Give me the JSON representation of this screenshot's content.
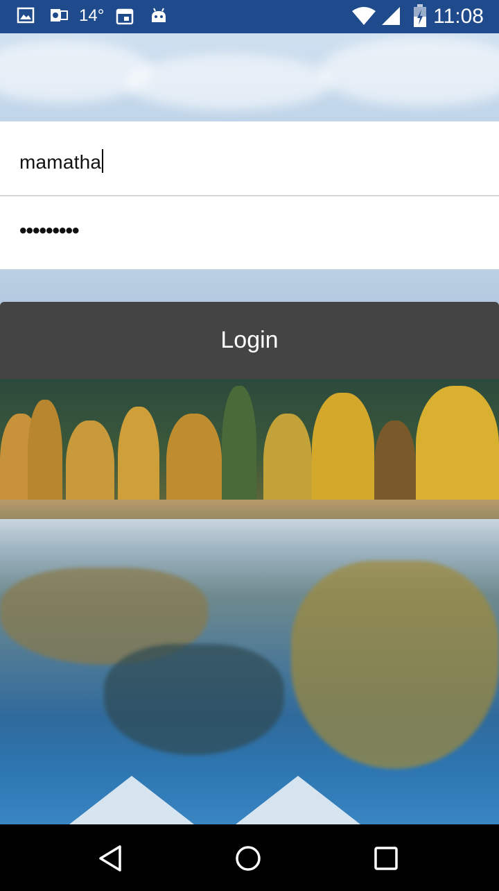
{
  "status_bar": {
    "icons": [
      "image-icon",
      "outlook-icon",
      "calendar-icon",
      "android-icon",
      "wifi-icon",
      "signal-icon",
      "battery-charging-icon"
    ],
    "temperature": "14°",
    "time": "11:08"
  },
  "login_form": {
    "username_value": "mamatha",
    "password_masked": "•••••••••",
    "login_label": "Login"
  },
  "nav_bar": {
    "icons": [
      "back-icon",
      "home-icon",
      "recents-icon"
    ]
  }
}
